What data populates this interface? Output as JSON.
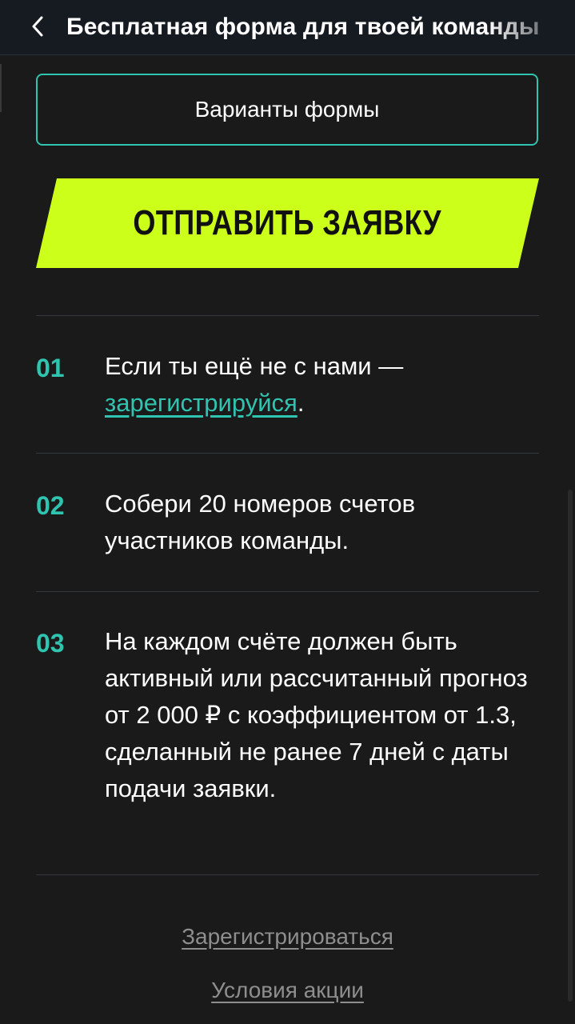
{
  "header": {
    "back_icon": "chevron-left-icon",
    "title": "Бесплатная форма для твоей команды"
  },
  "main": {
    "variants_button": "Варианты формы",
    "submit_button": "ОТПРАВИТЬ ЗАЯВКУ",
    "steps": [
      {
        "number": "01",
        "text_before": "Если ты ещё не с нами —",
        "link": "зарегистрируйся",
        "text_after": "."
      },
      {
        "number": "02",
        "text": "Собери 20 номеров счетов участников команды."
      },
      {
        "number": "03",
        "text": "На каждом счёте должен быть активный или рассчитанный прогноз от 2 000 ₽ с коэффициентом от 1.3, сделанный не ранее 7 дней с даты подачи заявки."
      }
    ]
  },
  "footer": {
    "register_link": "Зарегистрироваться",
    "terms_link": "Условия акции"
  },
  "colors": {
    "accent": "#2ec4b0",
    "cta": "#ccff1a",
    "background": "#1a1a1a",
    "header_bg": "#161b22"
  }
}
